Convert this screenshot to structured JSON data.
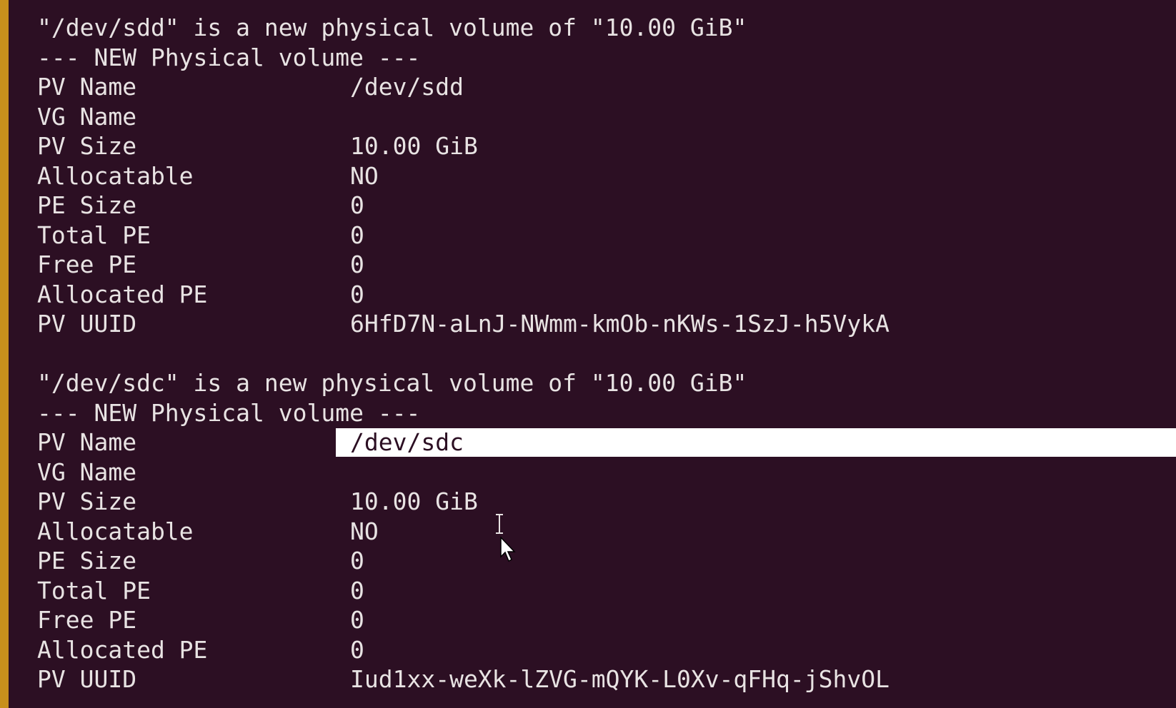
{
  "blocks": [
    {
      "header": "\"/dev/sdd\" is a new physical volume of \"10.00 GiB\"",
      "subheader": "--- NEW Physical volume ---",
      "rows": [
        {
          "label": "PV Name",
          "value": "/dev/sdd"
        },
        {
          "label": "VG Name",
          "value": ""
        },
        {
          "label": "PV Size",
          "value": "10.00 GiB"
        },
        {
          "label": "Allocatable",
          "value": "NO"
        },
        {
          "label": "PE Size",
          "value": "0"
        },
        {
          "label": "Total PE",
          "value": "0"
        },
        {
          "label": "Free PE",
          "value": "0"
        },
        {
          "label": "Allocated PE",
          "value": "0"
        },
        {
          "label": "PV UUID",
          "value": "6HfD7N-aLnJ-NWmm-kmOb-nKWs-1SzJ-h5VykA"
        }
      ]
    },
    {
      "header": "\"/dev/sdc\" is a new physical volume of \"10.00 GiB\"",
      "subheader": "--- NEW Physical volume ---",
      "rows": [
        {
          "label": "PV Name",
          "value": "/dev/sdc"
        },
        {
          "label": "VG Name",
          "value": ""
        },
        {
          "label": "PV Size",
          "value": "10.00 GiB"
        },
        {
          "label": "Allocatable",
          "value": "NO"
        },
        {
          "label": "PE Size",
          "value": "0"
        },
        {
          "label": "Total PE",
          "value": "0"
        },
        {
          "label": "Free PE",
          "value": "0"
        },
        {
          "label": "Allocated PE",
          "value": "0"
        },
        {
          "label": "PV UUID",
          "value": "Iud1xx-weXk-lZVG-mQYK-L0Xv-qFHq-jShvOL"
        }
      ]
    }
  ],
  "colors": {
    "background": "#2c0f23",
    "text": "#e8e3e3",
    "selection": "#ffffff",
    "window_border": "#c8901c"
  },
  "cursor": {
    "text_cursor_icon": "ibeam-cursor-icon",
    "pointer_icon": "mouse-pointer-icon"
  }
}
